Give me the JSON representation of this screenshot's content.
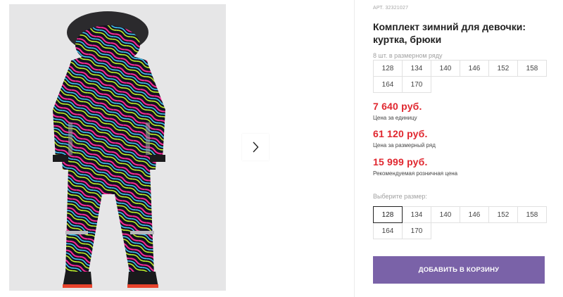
{
  "product": {
    "article_label": "АРТ.",
    "article_number": "32321027",
    "title": "Комплект зимний для девочки: куртка, брюки"
  },
  "pack": {
    "label": "8 шт. в размерном ряду",
    "sizes": [
      "128",
      "134",
      "140",
      "146",
      "152",
      "158",
      "164",
      "170"
    ]
  },
  "prices": {
    "unit_price": "7 640 руб.",
    "unit_caption": "Цена за единицу",
    "row_price": "61 120 руб.",
    "row_caption": "Цена за размерный ряд",
    "retail_price": "15 999 руб.",
    "retail_caption": "Рекомендуемая розничная цена"
  },
  "size_select": {
    "label": "Выберите размер:",
    "sizes": [
      "128",
      "134",
      "140",
      "146",
      "152",
      "158",
      "164",
      "170"
    ],
    "selected": "128"
  },
  "cart_button_label": "ДОБАВИТЬ В КОРЗИНУ",
  "icons": {
    "next": "chevron-right-icon"
  },
  "colors": {
    "price_red": "#e0272f",
    "button_purple": "#7a62a8"
  }
}
